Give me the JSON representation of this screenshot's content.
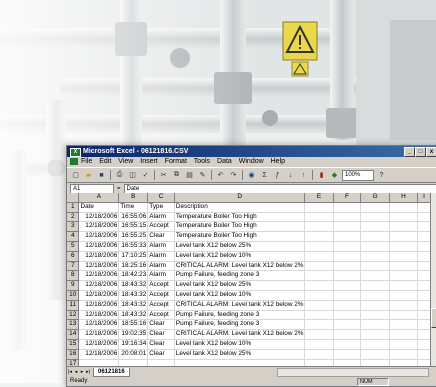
{
  "window": {
    "title": "Microsoft Excel - 06121816.CSV",
    "menu": [
      "File",
      "Edit",
      "View",
      "Insert",
      "Format",
      "Tools",
      "Data",
      "Window",
      "Help"
    ],
    "zoom": "100%"
  },
  "formula_bar": {
    "cell_ref": "A1",
    "fx": "=",
    "content": "Date"
  },
  "sheet": {
    "columns": [
      "A",
      "B",
      "C",
      "D",
      "E",
      "F",
      "G",
      "H",
      "I"
    ],
    "rows": [
      {
        "n": "1",
        "a": "Date",
        "b": "Time",
        "c": "Type",
        "d": "Description"
      },
      {
        "n": "2",
        "a": "12/18/2006",
        "b": "16:55:06",
        "c": "Alarm",
        "d": "Temperature Boiler Too High"
      },
      {
        "n": "3",
        "a": "12/18/2006",
        "b": "16:55:15",
        "c": "Accept",
        "d": "Temperature Boiler Too High"
      },
      {
        "n": "4",
        "a": "12/18/2006",
        "b": "16:55:25",
        "c": "Clear",
        "d": "Temperature Boiler Too High"
      },
      {
        "n": "5",
        "a": "12/18/2006",
        "b": "16:55:33",
        "c": "Alarm",
        "d": "Level tank X12 below 25%"
      },
      {
        "n": "6",
        "a": "12/18/2006",
        "b": "17:10:25",
        "c": "Alarm",
        "d": "Level tank X12 below 10%"
      },
      {
        "n": "7",
        "a": "12/18/2006",
        "b": "18:25:16",
        "c": "Alarm",
        "d": "CRITICAL ALARM: Level tank X12 below 2%"
      },
      {
        "n": "8",
        "a": "12/18/2006",
        "b": "18:42:23",
        "c": "Alarm",
        "d": "Pump Failure, feeding zone 3"
      },
      {
        "n": "9",
        "a": "12/18/2006",
        "b": "18:43:32",
        "c": "Accept",
        "d": "Level tank X12 below 25%"
      },
      {
        "n": "10",
        "a": "12/18/2006",
        "b": "18:43:32",
        "c": "Accept",
        "d": "Level tank X12 below 10%"
      },
      {
        "n": "11",
        "a": "12/18/2006",
        "b": "18:43:32",
        "c": "Accept",
        "d": "CRITICAL ALARM: Level tank X12 below 2%"
      },
      {
        "n": "12",
        "a": "12/18/2006",
        "b": "18:43:32",
        "c": "Accept",
        "d": "Pump Failure, feeding zone 3"
      },
      {
        "n": "13",
        "a": "12/18/2006",
        "b": "18:55:16",
        "c": "Clear",
        "d": "Pump Failure, feeding zone 3"
      },
      {
        "n": "14",
        "a": "12/18/2006",
        "b": "19:02:35",
        "c": "Clear",
        "d": "CRITICAL ALARM: Level tank X12 below 2%"
      },
      {
        "n": "15",
        "a": "12/18/2006",
        "b": "19:16:34",
        "c": "Clear",
        "d": "Level tank X12 below 10%"
      },
      {
        "n": "16",
        "a": "12/18/2006",
        "b": "20:08:01",
        "c": "Clear",
        "d": "Level tank X12 below 25%"
      },
      {
        "n": "17",
        "a": "",
        "b": "",
        "c": "",
        "d": ""
      }
    ],
    "active_tab": "06121816"
  },
  "status": {
    "left": "Ready",
    "num": "NUM"
  },
  "colors": {
    "title_bar": "#0a246a",
    "chrome": "#d4d0c8",
    "header_cell": "#d4d0c8"
  },
  "icons": [
    "excel-app-icon",
    "new-icon",
    "open-icon",
    "save-icon",
    "print-icon",
    "preview-icon",
    "cut-icon",
    "copy-icon",
    "paste-icon",
    "undo-icon",
    "sum-icon",
    "sort-icon",
    "chart-icon",
    "warning-sign-icon"
  ]
}
